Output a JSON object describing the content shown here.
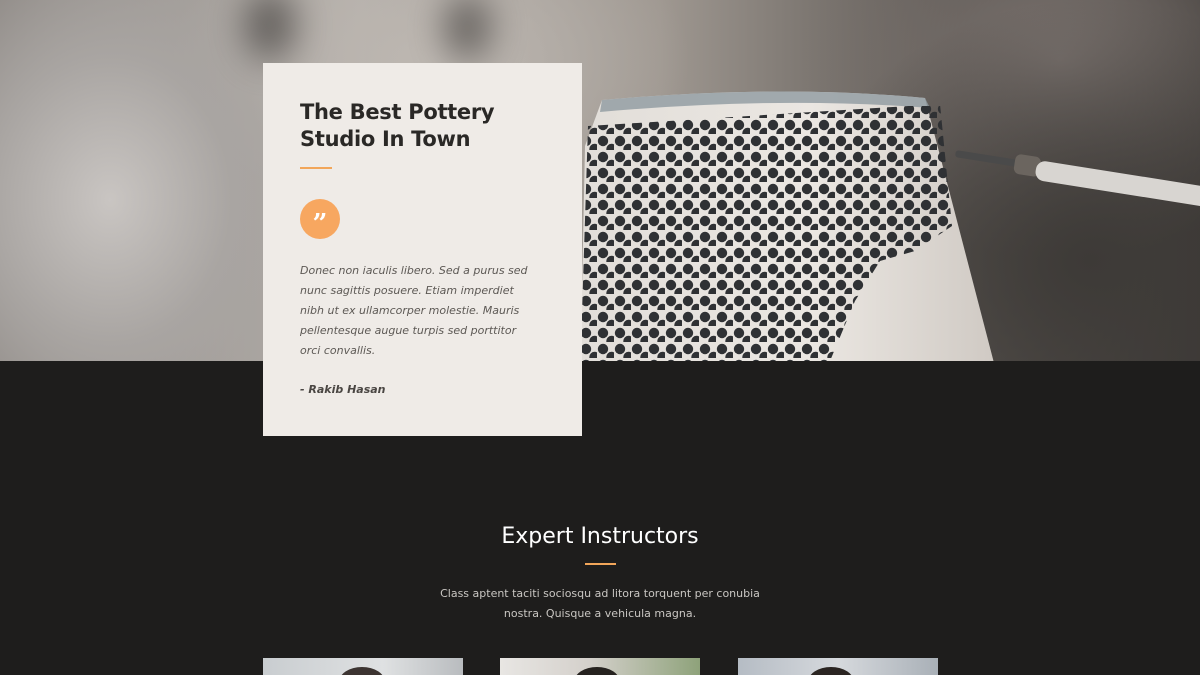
{
  "testimonial": {
    "title_line1": "The Best Pottery",
    "title_line2": "Studio In Town",
    "quote_glyph": "”",
    "body_lines": [
      "Donec non iaculis libero. Sed a purus sed",
      "nunc sagittis posuere. Etiam imperdiet",
      "nibh ut ex ullamcorper molestie. Mauris",
      "pellentesque augue turpis sed porttitor",
      "orci convallis."
    ],
    "author": "- Rakib Hasan"
  },
  "instructors_section": {
    "title": "Expert Instructors",
    "text_line1": "Class aptent taciti sociosqu ad litora torquent per conubia",
    "text_line2": "nostra. Quisque a vehicula magna."
  },
  "colors": {
    "accent": "#f7a760",
    "dark_background": "#1e1d1c",
    "card_background": "#efebe7"
  },
  "icons": {
    "quote": "quote-icon"
  }
}
